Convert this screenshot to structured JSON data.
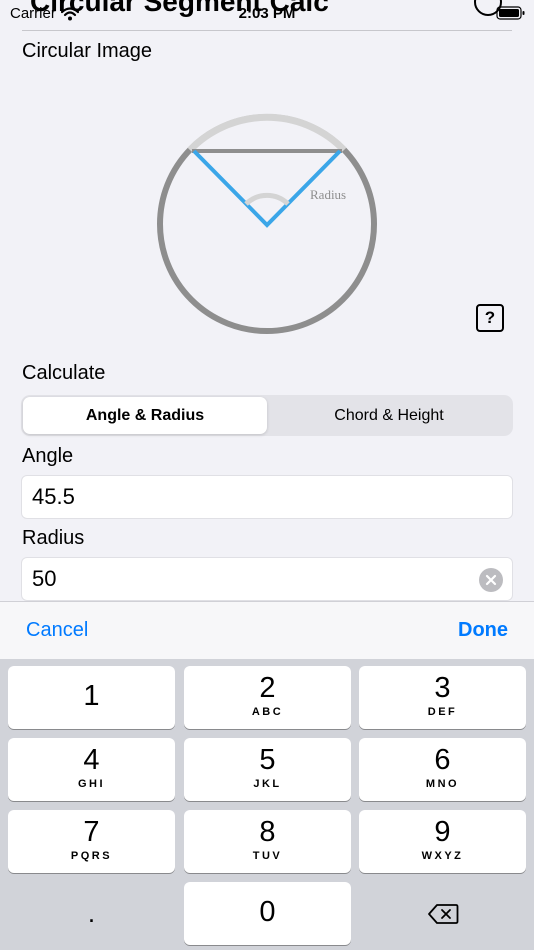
{
  "status_bar": {
    "carrier": "Carrier",
    "time": "2:03 PM"
  },
  "nav": {
    "title": "Circular Segment Calc"
  },
  "sections": {
    "circular_image": "Circular Image",
    "calculate": "Calculate"
  },
  "diagram": {
    "radius_label": "Radius",
    "colors": {
      "circle": "#8e8e8e",
      "arc": "#d4d4d4",
      "radius": "#3ba6e8",
      "chord": "#8e8e8e"
    }
  },
  "help_button": {
    "label": "?"
  },
  "mode_selector": {
    "options": [
      "Angle & Radius",
      "Chord & Height"
    ],
    "selected": "Angle & Radius"
  },
  "fields": {
    "angle": {
      "label": "Angle",
      "value": "45.5"
    },
    "radius": {
      "label": "Radius",
      "value": "50"
    }
  },
  "keyboard_toolbar": {
    "cancel": "Cancel",
    "done": "Done",
    "accent": "#007aff"
  },
  "keypad": {
    "keys": [
      {
        "digit": "1",
        "letters": ""
      },
      {
        "digit": "2",
        "letters": "ABC"
      },
      {
        "digit": "3",
        "letters": "DEF"
      },
      {
        "digit": "4",
        "letters": "GHI"
      },
      {
        "digit": "5",
        "letters": "JKL"
      },
      {
        "digit": "6",
        "letters": "MNO"
      },
      {
        "digit": "7",
        "letters": "PQRS"
      },
      {
        "digit": "8",
        "letters": "TUV"
      },
      {
        "digit": "9",
        "letters": "WXYZ"
      },
      {
        "digit": "0",
        "letters": ""
      }
    ],
    "decimal": ".",
    "delete_icon": "delete-backward-icon"
  }
}
